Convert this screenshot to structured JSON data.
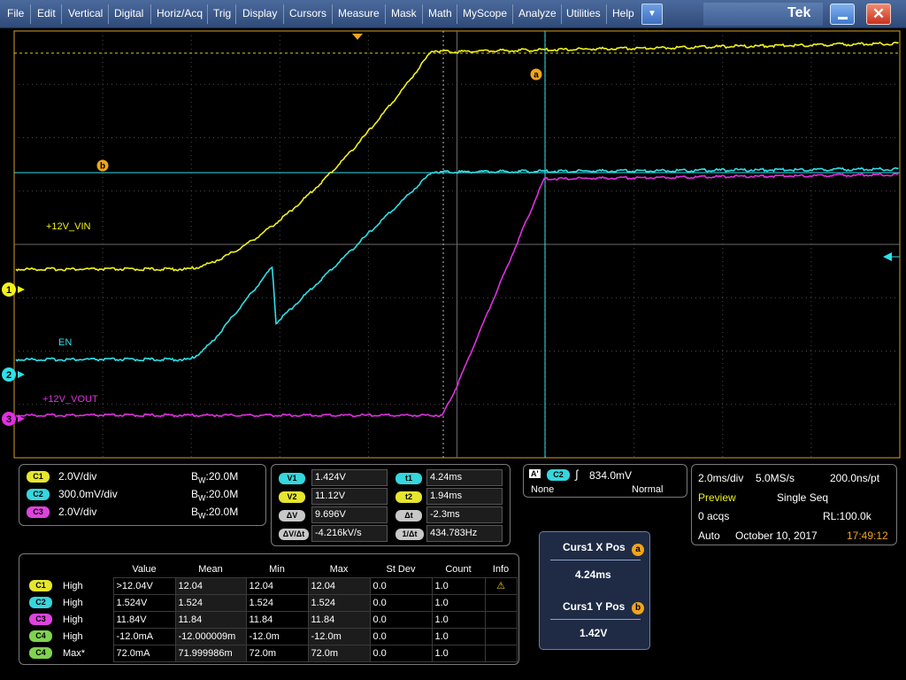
{
  "menu": [
    "File",
    "Edit",
    "Vertical",
    "Digital",
    "Horiz/Acq",
    "Trig",
    "Display",
    "Cursors",
    "Measure",
    "Mask",
    "Math",
    "MyScope",
    "Analyze",
    "Utilities",
    "Help"
  ],
  "brand": "Tek",
  "menu_dropdown_icon": "chevron-down-icon",
  "colors": {
    "ch1": "#f2f21a",
    "ch2": "#30e0e8",
    "ch3": "#e030e0",
    "ch4": "#7ed34f",
    "grid": "#4a4a4a",
    "cursor": "#30e0e8",
    "accent": "#f0a51c"
  },
  "traces": {
    "ch1": {
      "label": "+12V_VIN",
      "marker": "1"
    },
    "ch2": {
      "label": "EN",
      "marker": "2"
    },
    "ch3": {
      "label": "+12V_VOUT",
      "marker": "3"
    }
  },
  "cursor_badges": {
    "a": "a",
    "b": "b"
  },
  "channels": [
    {
      "chip": "C1",
      "scale": "2.0V/div",
      "bw_prefix": "B",
      "bw_sub": "W",
      "bw_value": ":20.0M"
    },
    {
      "chip": "C2",
      "scale": "300.0mV/div",
      "bw_prefix": "B",
      "bw_sub": "W",
      "bw_value": ":20.0M"
    },
    {
      "chip": "C3",
      "scale": "2.0V/div",
      "bw_prefix": "B",
      "bw_sub": "W",
      "bw_value": ":20.0M"
    }
  ],
  "cursor_readout": {
    "v1_label": "V1",
    "v1": "1.424V",
    "v2_label": "V2",
    "v2": "11.12V",
    "dv_label": "ΔV",
    "dv": "9.696V",
    "dvdt_label": "ΔV/Δt",
    "dvdt": "-4.216kV/s",
    "t1_label": "t1",
    "t1": "4.24ms",
    "t2_label": "t2",
    "t2": "1.94ms",
    "dt_label": "Δt",
    "dt": "-2.3ms",
    "inv_label": "1/Δt",
    "inv_dt": "434.783Hz"
  },
  "trigger": {
    "source_badge": "A'",
    "source_chip": "C2",
    "level": "834.0mV",
    "coupling": "None",
    "mode": "Normal"
  },
  "acquisition": {
    "timebase": "2.0ms/div",
    "sample_rate": "5.0MS/s",
    "resolution": "200.0ns/pt",
    "state": "Preview",
    "run_mode": "Single Seq",
    "acqs": "0 acqs",
    "record_length": "RL:100.0k",
    "trigger_mode": "Auto",
    "date": "October 10, 2017",
    "time": "17:49:12"
  },
  "measurements": {
    "headers": [
      "Value",
      "Mean",
      "Min",
      "Max",
      "St Dev",
      "Count",
      "Info"
    ],
    "rows": [
      {
        "chip": "C1",
        "type": "High",
        "value": ">12.04V",
        "mean": "12.04",
        "min": "12.04",
        "max": "12.04",
        "stdev": "0.0",
        "count": "1.0",
        "info": "⚠"
      },
      {
        "chip": "C2",
        "type": "High",
        "value": "1.524V",
        "mean": "1.524",
        "min": "1.524",
        "max": "1.524",
        "stdev": "0.0",
        "count": "1.0",
        "info": ""
      },
      {
        "chip": "C3",
        "type": "High",
        "value": "11.84V",
        "mean": "11.84",
        "min": "11.84",
        "max": "11.84",
        "stdev": "0.0",
        "count": "1.0",
        "info": ""
      },
      {
        "chip": "C4",
        "type": "High",
        "value": "-12.0mA",
        "mean": "-12.000009m",
        "min": "-12.0m",
        "max": "-12.0m",
        "stdev": "0.0",
        "count": "1.0",
        "info": ""
      },
      {
        "chip": "C4",
        "type": "Max*",
        "value": "72.0mA",
        "mean": "71.999986m",
        "min": "72.0m",
        "max": "72.0m",
        "stdev": "0.0",
        "count": "1.0",
        "info": ""
      }
    ]
  },
  "cursor_pos": {
    "x_title": "Curs1 X Pos",
    "x_badge": "a",
    "x_value": "4.24ms",
    "y_title": "Curs1 Y Pos",
    "y_badge": "b",
    "y_value": "1.42V"
  }
}
